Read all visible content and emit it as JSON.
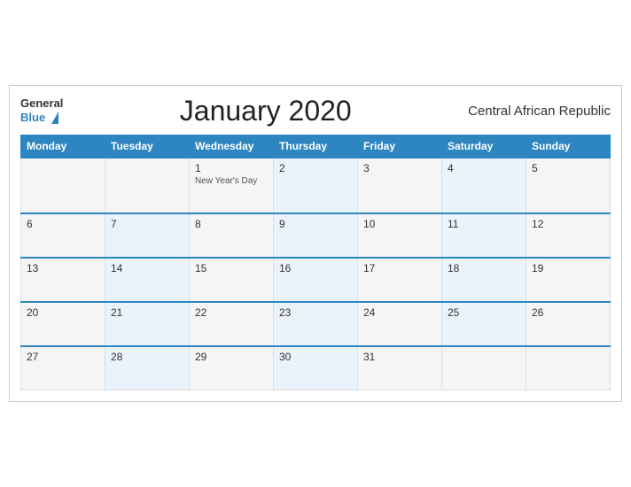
{
  "header": {
    "logo_general": "General",
    "logo_blue": "Blue",
    "title": "January 2020",
    "country": "Central African Republic"
  },
  "days_of_week": [
    "Monday",
    "Tuesday",
    "Wednesday",
    "Thursday",
    "Friday",
    "Saturday",
    "Sunday"
  ],
  "weeks": [
    [
      {
        "day": "",
        "holiday": ""
      },
      {
        "day": "",
        "holiday": ""
      },
      {
        "day": "1",
        "holiday": "New Year's Day"
      },
      {
        "day": "2",
        "holiday": ""
      },
      {
        "day": "3",
        "holiday": ""
      },
      {
        "day": "4",
        "holiday": ""
      },
      {
        "day": "5",
        "holiday": ""
      }
    ],
    [
      {
        "day": "6",
        "holiday": ""
      },
      {
        "day": "7",
        "holiday": ""
      },
      {
        "day": "8",
        "holiday": ""
      },
      {
        "day": "9",
        "holiday": ""
      },
      {
        "day": "10",
        "holiday": ""
      },
      {
        "day": "11",
        "holiday": ""
      },
      {
        "day": "12",
        "holiday": ""
      }
    ],
    [
      {
        "day": "13",
        "holiday": ""
      },
      {
        "day": "14",
        "holiday": ""
      },
      {
        "day": "15",
        "holiday": ""
      },
      {
        "day": "16",
        "holiday": ""
      },
      {
        "day": "17",
        "holiday": ""
      },
      {
        "day": "18",
        "holiday": ""
      },
      {
        "day": "19",
        "holiday": ""
      }
    ],
    [
      {
        "day": "20",
        "holiday": ""
      },
      {
        "day": "21",
        "holiday": ""
      },
      {
        "day": "22",
        "holiday": ""
      },
      {
        "day": "23",
        "holiday": ""
      },
      {
        "day": "24",
        "holiday": ""
      },
      {
        "day": "25",
        "holiday": ""
      },
      {
        "day": "26",
        "holiday": ""
      }
    ],
    [
      {
        "day": "27",
        "holiday": ""
      },
      {
        "day": "28",
        "holiday": ""
      },
      {
        "day": "29",
        "holiday": ""
      },
      {
        "day": "30",
        "holiday": ""
      },
      {
        "day": "31",
        "holiday": ""
      },
      {
        "day": "",
        "holiday": ""
      },
      {
        "day": "",
        "holiday": ""
      }
    ]
  ]
}
